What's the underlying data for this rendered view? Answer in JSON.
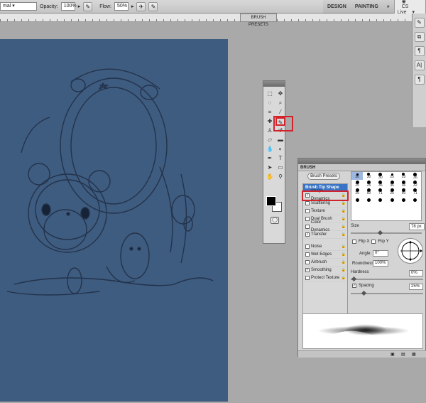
{
  "options_bar": {
    "mode_value": "mal",
    "opacity_label": "Opacity:",
    "opacity_value": "100%",
    "flow_label": "Flow:",
    "flow_value": "50%"
  },
  "app_bar": {
    "workspace_design": "DESIGN",
    "workspace_painting": "PAINTING",
    "more": "»",
    "cs_live": "CS Live"
  },
  "ruler": {
    "brush_presets_tab": "BRUSH PRESETS"
  },
  "dock_icons": [
    "brush-icon",
    "pilcrow-icon",
    "character-icon",
    "clone-icon"
  ],
  "toolbox": {
    "tools": [
      "marquee-icon",
      "move-icon",
      "lasso-icon",
      "quick-select-icon",
      "crop-icon",
      "eyedropper-icon",
      "healing-icon",
      "brush-icon",
      "stamp-icon",
      "history-brush-icon",
      "eraser-icon",
      "gradient-icon",
      "blur-icon",
      "dodge-icon",
      "pen-icon",
      "type-icon",
      "path-select-icon",
      "shape-icon",
      "hand-icon",
      "zoom-icon"
    ]
  },
  "brush_panel": {
    "title": "BRUSH",
    "presets_button": "Brush Presets",
    "options": [
      {
        "label": "Brush Tip Shape",
        "checked": null,
        "selected": true
      },
      {
        "label": "Shape Dynamics",
        "checked": true,
        "selected": false
      },
      {
        "label": "Scattering",
        "checked": false,
        "selected": false
      },
      {
        "label": "Texture",
        "checked": false,
        "selected": false
      },
      {
        "label": "Dual Brush",
        "checked": false,
        "selected": false
      },
      {
        "label": "Color Dynamics",
        "checked": false,
        "selected": false
      },
      {
        "label": "Transfer",
        "checked": true,
        "selected": false
      },
      {
        "label": "Noise",
        "checked": false,
        "selected": false
      },
      {
        "label": "Wet Edges",
        "checked": false,
        "selected": false
      },
      {
        "label": "Airbrush",
        "checked": false,
        "selected": false
      },
      {
        "label": "Smoothing",
        "checked": true,
        "selected": false
      },
      {
        "label": "Protect Texture",
        "checked": false,
        "selected": false
      }
    ],
    "tip_sizes": [
      "30",
      "30",
      "30",
      "25",
      "25",
      "36",
      "25",
      "25",
      "36",
      "36",
      "36",
      "32",
      "25",
      "50",
      "71",
      "25",
      "50",
      "71",
      "",
      "",
      "",
      "",
      "",
      ""
    ],
    "size_label": "Size",
    "size_value": "78 px",
    "flip_x": "Flip X",
    "flip_y": "Flip Y",
    "angle_label": "Angle:",
    "angle_value": "0°",
    "roundness_label": "Roundness:",
    "roundness_value": "100%",
    "hardness_label": "Hardness",
    "hardness_value": "0%",
    "spacing_label": "Spacing",
    "spacing_value": "25%"
  }
}
